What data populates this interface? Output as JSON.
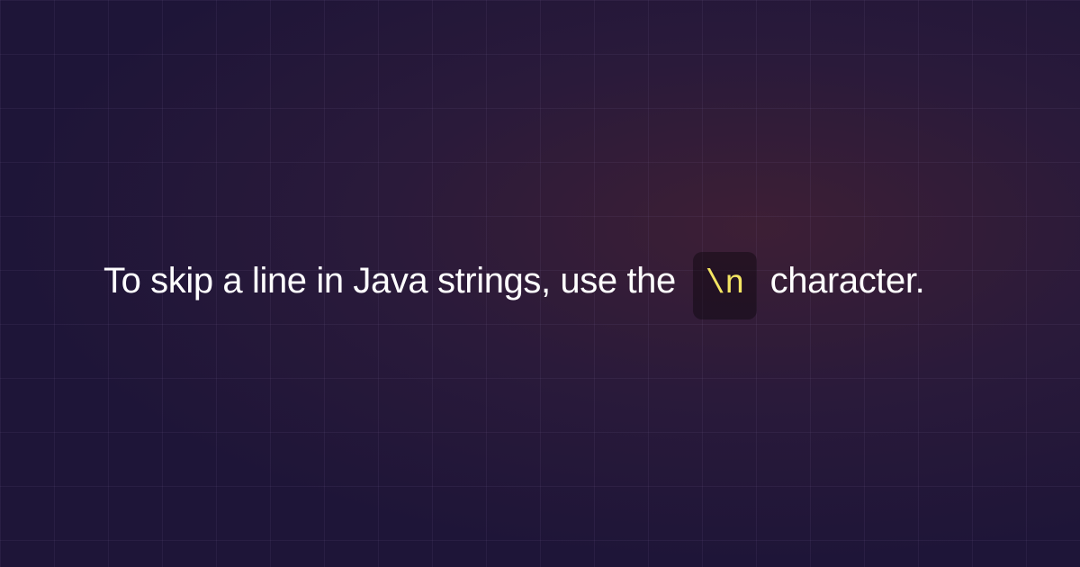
{
  "content": {
    "text_before": "To skip a line in Java strings, use the ",
    "code_token": "\\n",
    "text_after": " character."
  },
  "colors": {
    "code_color": "#f5e663",
    "text_color": "#ffffff"
  }
}
